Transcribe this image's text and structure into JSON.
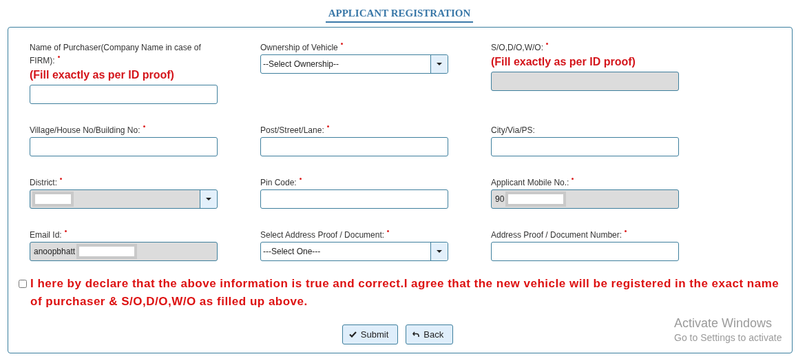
{
  "title": "APPLICANT REGISTRATION",
  "fields": [
    {
      "label": "Name of Purchaser(Company Name in case of FIRM):",
      "required": true,
      "note": "(Fill exactly as per ID proof)",
      "kind": "input",
      "disabled": false
    },
    {
      "label": "Ownership of Vehicle",
      "required": true,
      "kind": "select",
      "disabled": false,
      "value": "--Select Ownership--"
    },
    {
      "label": "S/O,D/O,W/O:",
      "required": true,
      "note": "(Fill exactly as per ID proof)",
      "kind": "input",
      "disabled": true
    },
    {
      "label": "Village/House No/Building No:",
      "required": true,
      "kind": "input",
      "disabled": false
    },
    {
      "label": "Post/Street/Lane:",
      "required": true,
      "kind": "input",
      "disabled": false
    },
    {
      "label": "City/Via/PS:",
      "required": false,
      "kind": "input",
      "disabled": false
    },
    {
      "label": "District:",
      "required": true,
      "kind": "select",
      "disabled": true,
      "redacted": true
    },
    {
      "label": "Pin Code:",
      "required": true,
      "kind": "input",
      "disabled": false
    },
    {
      "label": "Applicant Mobile No.:",
      "required": true,
      "kind": "input",
      "disabled": true,
      "value": "90",
      "redacted": true
    },
    {
      "label": "Email Id:",
      "required": true,
      "kind": "input",
      "disabled": true,
      "value": "anoopbhatt",
      "redacted": true
    },
    {
      "label": "Select Address Proof / Document:",
      "required": true,
      "kind": "select",
      "disabled": false,
      "value": "---Select One---"
    },
    {
      "label": "Address Proof / Document Number:",
      "required": true,
      "kind": "input",
      "disabled": false
    }
  ],
  "declaration": {
    "checked": false,
    "text": "I here by declare that the above information is true and correct.I agree that the new vehicle will be registered in the exact name of purchaser & S/O,D/O,W/O as filled up above."
  },
  "buttons": [
    {
      "label": "Submit",
      "kind": "submit"
    },
    {
      "label": "Back",
      "kind": "back"
    }
  ],
  "os_overlay": {
    "title": "Activate Windows",
    "subtitle": "Go to Settings to activate"
  }
}
